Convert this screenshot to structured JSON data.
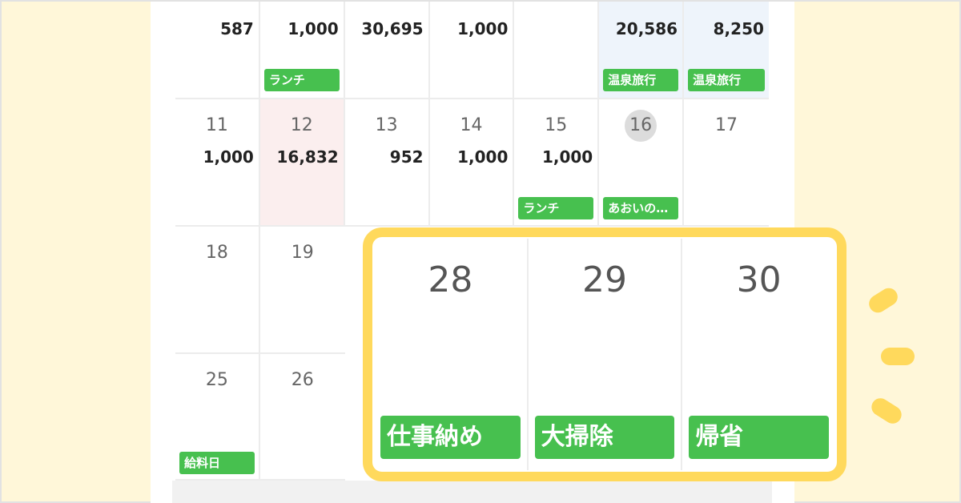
{
  "calendar": {
    "row1": [
      {
        "amount": "587"
      },
      {
        "amount": "1,000",
        "tag": "ランチ"
      },
      {
        "amount": "30,695"
      },
      {
        "amount": "1,000"
      },
      {
        "amount": ""
      },
      {
        "amount": "20,586",
        "tag": "温泉旅行"
      },
      {
        "amount": "8,250",
        "tag": "温泉旅行"
      }
    ],
    "row2": [
      {
        "day": "11",
        "amount": "1,000"
      },
      {
        "day": "12",
        "amount": "16,832"
      },
      {
        "day": "13",
        "amount": "952"
      },
      {
        "day": "14",
        "amount": "1,000"
      },
      {
        "day": "15",
        "amount": "1,000",
        "tag": "ランチ"
      },
      {
        "day": "16",
        "amount": "",
        "tag": "あおいの…"
      },
      {
        "day": "17",
        "amount": ""
      }
    ],
    "row3": [
      {
        "day": "18"
      },
      {
        "day": "19"
      }
    ],
    "row4": [
      {
        "day": "25",
        "tag": "給料日"
      },
      {
        "day": "26"
      }
    ]
  },
  "highlight": {
    "days": [
      {
        "day": "28",
        "tag": "仕事納め"
      },
      {
        "day": "29",
        "tag": "大掃除"
      },
      {
        "day": "30",
        "tag": "帰省"
      }
    ]
  },
  "colors": {
    "accent_yellow": "#ffd95c",
    "tag_green": "#47c04f",
    "background": "#fff7d9"
  }
}
